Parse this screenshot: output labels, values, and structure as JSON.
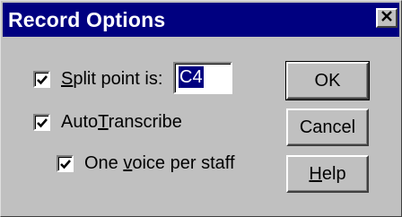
{
  "window": {
    "title": "Record Options"
  },
  "titlebar": {
    "close_icon": "close-icon"
  },
  "split_point": {
    "label_pre": "",
    "label_mnemonic": "S",
    "label_rest": "plit point is:",
    "checked": true,
    "value": "C4"
  },
  "auto_transcribe": {
    "label_pre": "Auto",
    "label_mnemonic": "T",
    "label_rest": "ranscribe",
    "checked": true
  },
  "one_voice": {
    "label_pre": "One ",
    "label_mnemonic": "v",
    "label_rest": "oice per staff",
    "checked": true
  },
  "buttons": {
    "ok": "OK",
    "cancel": "Cancel",
    "help_mnemonic": "H",
    "help_rest": "elp"
  },
  "colors": {
    "titlebar": "#000080",
    "face": "#c0c0c0",
    "selection": "#000080"
  }
}
